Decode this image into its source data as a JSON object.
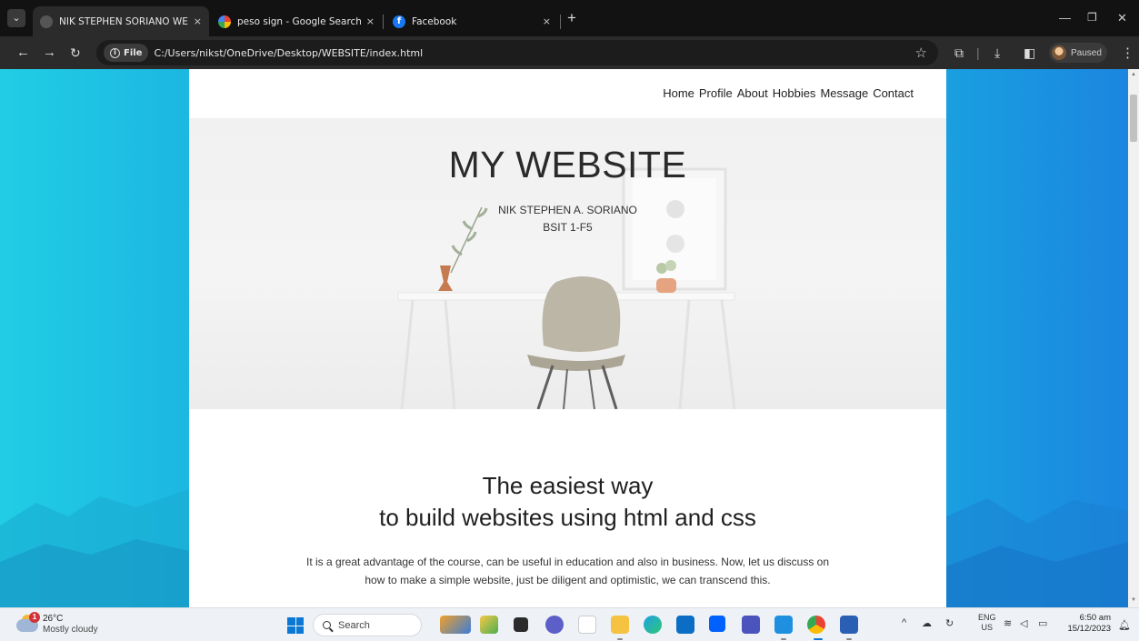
{
  "browser": {
    "tabs": [
      {
        "title": "NIK STEPHEN SORIANO WEBSI",
        "active": true
      },
      {
        "title": "peso sign - Google Search",
        "active": false
      },
      {
        "title": "Facebook",
        "active": false
      }
    ],
    "new_tab": "+",
    "close_glyph": "×",
    "address_chip": "File",
    "url": "C:/Users/nikst/OneDrive/Desktop/WEBSITE/index.html",
    "profile_status": "Paused"
  },
  "site": {
    "nav": [
      "Home",
      "Profile",
      "About",
      "Hobbies",
      "Message",
      "Contact"
    ],
    "hero": {
      "title": "MY WEBSITE",
      "name": "NIK STEPHEN A. SORIANO",
      "course": "BSIT 1-F5"
    },
    "headline_line1": "The easiest way",
    "headline_line2": "to build websites using html and css",
    "paragraph_line1": "It is a great advantage of the course, can be useful in education and also in business. Now, let us discuss on",
    "paragraph_line2": "how to make a simple website, just be diligent and optimistic, we can transcend this."
  },
  "taskbar": {
    "weather_temp": "26°C",
    "weather_desc": "Mostly cloudy",
    "weather_badge": "1",
    "search_label": "Search",
    "lang_line1": "ENG",
    "lang_line2": "US",
    "time": "6:50 am",
    "date": "15/12/2023"
  },
  "colors": {
    "desktop_gradient_left": "#21cde4",
    "desktop_gradient_right": "#1b86e0",
    "browser_dark": "#2b2b2b",
    "windows_accent": "#0a78d4"
  },
  "icons": [
    "tab-search-icon",
    "back-arrow-icon",
    "forward-arrow-icon",
    "reload-icon",
    "info-icon",
    "star-icon",
    "extensions-icon",
    "download-icon",
    "side-panel-icon",
    "kebab-menu-icon",
    "windows-start-icon",
    "search-icon",
    "bell-icon"
  ]
}
